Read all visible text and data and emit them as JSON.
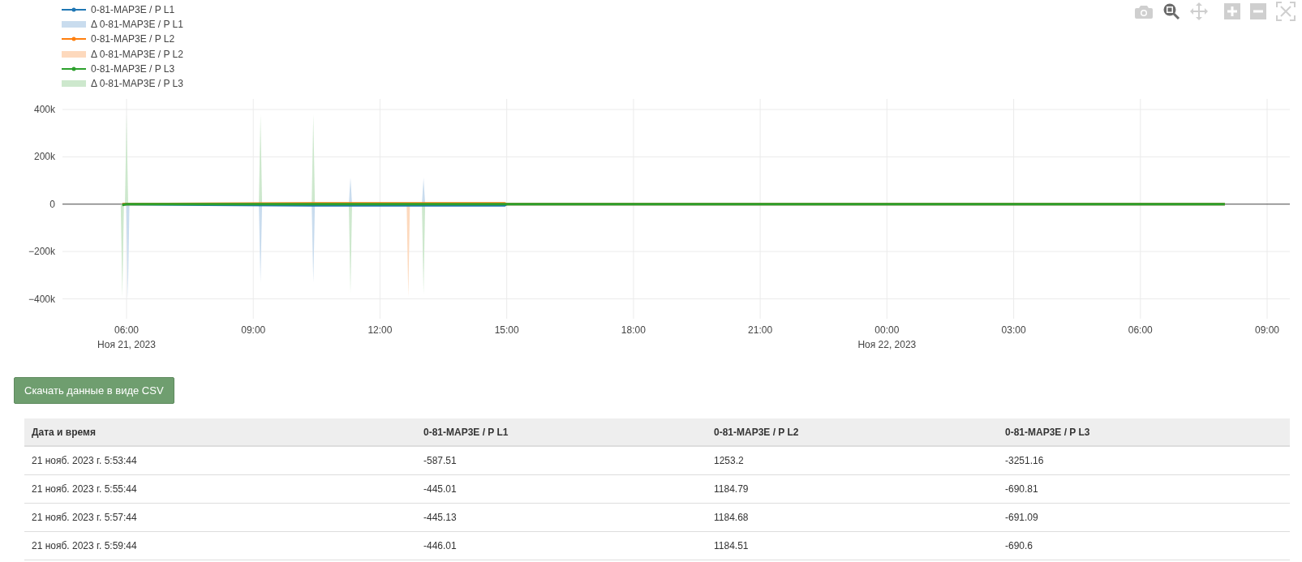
{
  "chart": {
    "modebar": [
      {
        "kind": "camera",
        "selected": false
      },
      {
        "kind": "zoom",
        "selected": true
      },
      {
        "kind": "pan",
        "selected": false
      },
      {
        "kind": "zoom-in",
        "selected": false
      },
      {
        "kind": "zoom-out",
        "selected": false
      },
      {
        "kind": "autoscale",
        "selected": false
      }
    ],
    "legend": [
      {
        "label": "0-81-MAP3E / P L1",
        "kind": "line",
        "color": "#1f77b4"
      },
      {
        "label": "Δ 0-81-MAP3E / P L1",
        "kind": "band",
        "color": "#c9dcee"
      },
      {
        "label": "0-81-MAP3E / P L2",
        "kind": "line",
        "color": "#ff7f0e"
      },
      {
        "label": "Δ 0-81-MAP3E / P L2",
        "kind": "band",
        "color": "#fdd9bd"
      },
      {
        "label": "0-81-MAP3E / P L3",
        "kind": "line",
        "color": "#2ca02c"
      },
      {
        "label": "Δ 0-81-MAP3E / P L3",
        "kind": "band",
        "color": "#cde8cd"
      }
    ],
    "y_axis": [
      "400k",
      "200k",
      "0",
      "−200k",
      "−400k"
    ],
    "x_axis": [
      {
        "label": "06:00",
        "date": "Ноя 21, 2023"
      },
      {
        "label": "09:00"
      },
      {
        "label": "12:00"
      },
      {
        "label": "15:00"
      },
      {
        "label": "18:00"
      },
      {
        "label": "21:00"
      },
      {
        "label": "00:00",
        "date": "Ноя 22, 2023"
      },
      {
        "label": "03:00"
      },
      {
        "label": "06:00"
      },
      {
        "label": "09:00"
      }
    ]
  },
  "download_button": {
    "label": "Скачать данные в виде CSV"
  },
  "table": {
    "columns": [
      "Дата и время",
      "0-81-MAP3E / P L1",
      "0-81-MAP3E / P L2",
      "0-81-MAP3E / P L3"
    ],
    "rows": [
      [
        "21 нояб. 2023 г. 5:53:44",
        "-587.51",
        "1253.2",
        "-3251.16"
      ],
      [
        "21 нояб. 2023 г. 5:55:44",
        "-445.01",
        "1184.79",
        "-690.81"
      ],
      [
        "21 нояб. 2023 г. 5:57:44",
        "-445.13",
        "1184.68",
        "-691.09"
      ],
      [
        "21 нояб. 2023 г. 5:59:44",
        "-446.01",
        "1184.51",
        "-690.6"
      ]
    ]
  }
}
